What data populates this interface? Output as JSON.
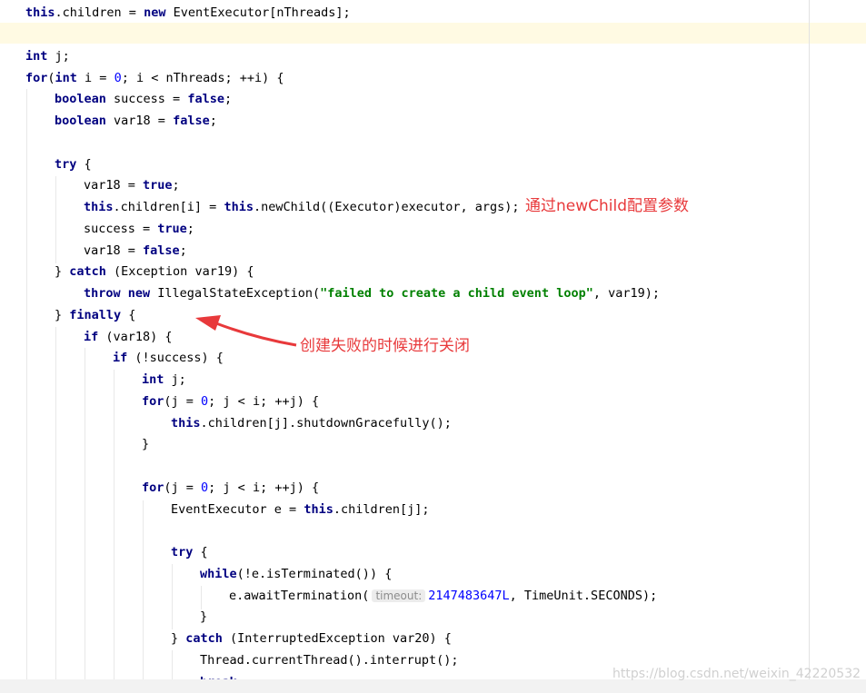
{
  "code": {
    "l01": {
      "this": "this",
      "rest_a": ".children = ",
      "new": "new",
      "rest_b": " EventExecutor[nThreads];"
    },
    "l03": {
      "int": "int",
      "rest": " j;"
    },
    "l04": {
      "for": "for",
      "p1": "(",
      "int": "int",
      "p2": " i = ",
      "zero": "0",
      "p3": "; i < nThreads; ++i) {"
    },
    "l05": {
      "boolean": "boolean",
      "p1": " success = ",
      "false": "false",
      "p2": ";"
    },
    "l06": {
      "boolean": "boolean",
      "p1": " var18 = ",
      "false": "false",
      "p2": ";"
    },
    "l08": {
      "try": "try",
      "p1": " {"
    },
    "l09": {
      "p1": "var18 = ",
      "true": "true",
      "p2": ";"
    },
    "l10": {
      "this1": "this",
      "p1": ".children[i] = ",
      "this2": "this",
      "p2": ".newChild((Executor)executor, args);"
    },
    "l11": {
      "p1": "success = ",
      "true": "true",
      "p2": ";"
    },
    "l12": {
      "p1": "var18 = ",
      "false": "false",
      "p2": ";"
    },
    "l13": {
      "p1": "} ",
      "catch": "catch",
      "p2": " (Exception var19) {"
    },
    "l14": {
      "throw": "throw",
      "p1": " ",
      "new": "new",
      "p2": " IllegalStateException(",
      "str": "\"failed to create a child event loop\"",
      "p3": ", var19);"
    },
    "l15": {
      "p1": "} ",
      "finally": "finally",
      "p2": " {"
    },
    "l16": {
      "if": "if",
      "p1": " (var18) {"
    },
    "l17": {
      "if": "if",
      "p1": " (!success) {"
    },
    "l18": {
      "int": "int",
      "p1": " j;"
    },
    "l19": {
      "for": "for",
      "p1": "(j = ",
      "zero": "0",
      "p2": "; j < i; ++j) {"
    },
    "l20": {
      "this": "this",
      "p1": ".children[j].shutdownGracefully();"
    },
    "l21": {
      "p1": "}"
    },
    "l23": {
      "for": "for",
      "p1": "(j = ",
      "zero": "0",
      "p2": "; j < i; ++j) {"
    },
    "l24": {
      "p1": "EventExecutor e = ",
      "this": "this",
      "p2": ".children[j];"
    },
    "l26": {
      "try": "try",
      "p1": " {"
    },
    "l27": {
      "while": "while",
      "p1": "(!e.isTerminated()) {"
    },
    "l28": {
      "p1": "e.awaitTermination(",
      "hint": "timeout:",
      "num": "2147483647L",
      "p2": ", TimeUnit.SECONDS);"
    },
    "l29": {
      "p1": "}"
    },
    "l30": {
      "p1": "} ",
      "catch": "catch",
      "p2": " (InterruptedException var20) {"
    },
    "l31": {
      "p1": "Thread.currentThread().interrupt();"
    },
    "l32": {
      "break": "break",
      "p1": ";"
    }
  },
  "annotations": {
    "newchild_note": "通过newChild配置参数",
    "close_note": "创建失败的时候进行关闭"
  },
  "watermark": "https://blog.csdn.net/weixin_42220532",
  "colors": {
    "keyword": "#000080",
    "number": "#0000ff",
    "string": "#008000",
    "annotation": "#e8393b",
    "caret_row": "#fffae3"
  }
}
